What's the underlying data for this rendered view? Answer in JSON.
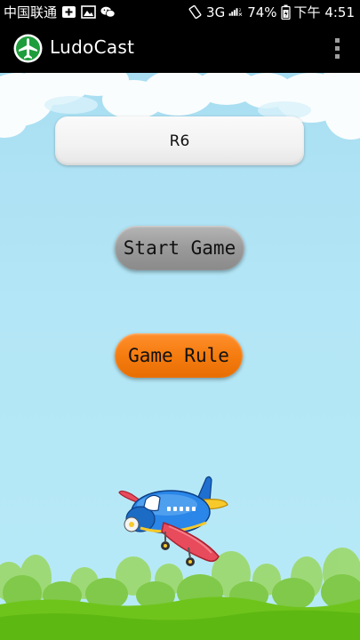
{
  "status_bar": {
    "carrier": "中国联通",
    "network": "3G",
    "battery": "74%",
    "time": "下午 4:51"
  },
  "app": {
    "title": "LudoCast"
  },
  "main": {
    "room_code": "R6",
    "start_button": "Start Game",
    "rule_button": "Game Rule"
  },
  "colors": {
    "sky": "#b3e6f6",
    "grass": "#6fc41c",
    "start_button": "#9a9a9a",
    "rule_button": "#f57c0f",
    "app_icon": "#1e9d3c"
  },
  "icons": [
    "add-box-icon",
    "image-icon",
    "wechat-icon",
    "rotate-icon",
    "signal-icon",
    "battery-icon",
    "airplane-app-icon",
    "overflow-menu-icon"
  ]
}
